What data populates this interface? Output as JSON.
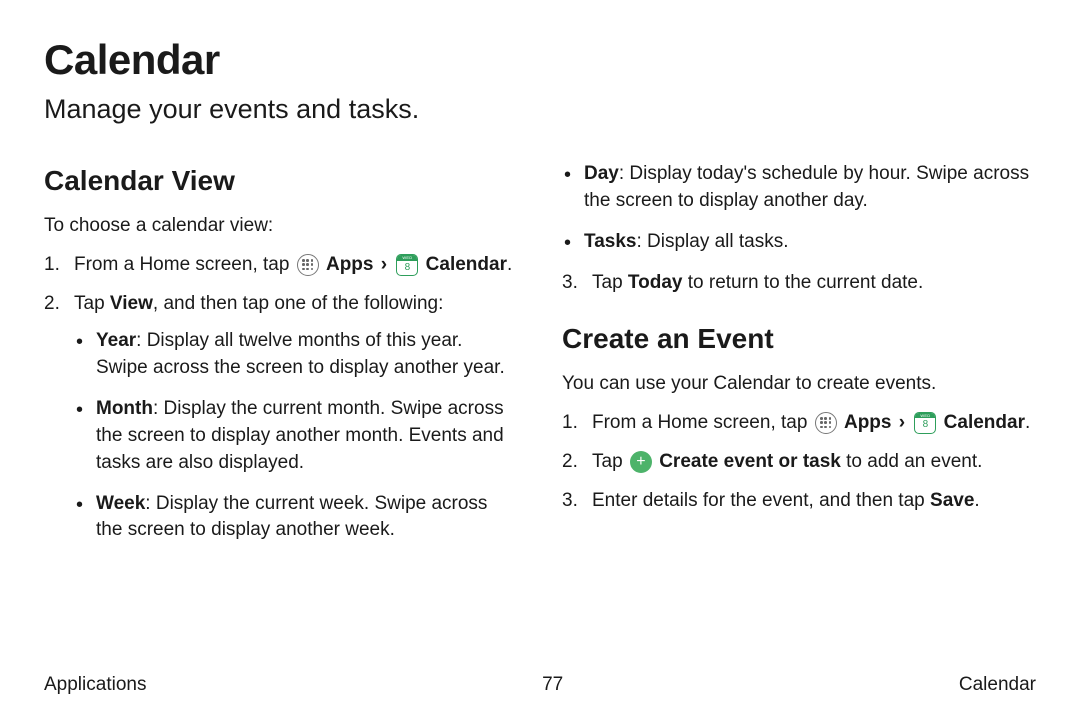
{
  "title": "Calendar",
  "subtitle": "Manage your events and tasks.",
  "sections": {
    "calendarView": {
      "heading": "Calendar View",
      "intro": "To choose a calendar view:",
      "step1_pre": "From a Home screen, tap ",
      "apps_label": "Apps",
      "calendar_label": "Calendar",
      "step2_pre": "Tap ",
      "step2_bold": "View",
      "step2_post": ", and then tap one of the following:",
      "year_label": "Year",
      "year_desc": ": Display all twelve months of this year. Swipe across the screen to display another year.",
      "month_label": "Month",
      "month_desc": ": Display the current month. Swipe across the screen to display another month. Events and tasks are also displayed.",
      "week_label": "Week",
      "week_desc": ": Display the current week. Swipe across the screen to display another week.",
      "day_label": "Day",
      "day_desc": ": Display today's schedule by hour. Swipe across the screen to display another day.",
      "tasks_label": "Tasks",
      "tasks_desc": ": Display all tasks.",
      "step3_pre": "Tap ",
      "step3_bold": "Today",
      "step3_post": " to return to the current date."
    },
    "createEvent": {
      "heading": "Create an Event",
      "intro": "You can use your Calendar to create events.",
      "step1_pre": "From a Home screen, tap ",
      "apps_label": "Apps",
      "calendar_label": "Calendar",
      "step2_pre": "Tap ",
      "step2_bold": "Create event or task",
      "step2_post": " to add an event.",
      "step3_pre": "Enter details for the event, and then tap ",
      "step3_bold": "Save",
      "step3_post": "."
    }
  },
  "icons": {
    "calendar_day": "8",
    "calendar_strip": "WED"
  },
  "footer": {
    "left": "Applications",
    "center": "77",
    "right": "Calendar"
  }
}
